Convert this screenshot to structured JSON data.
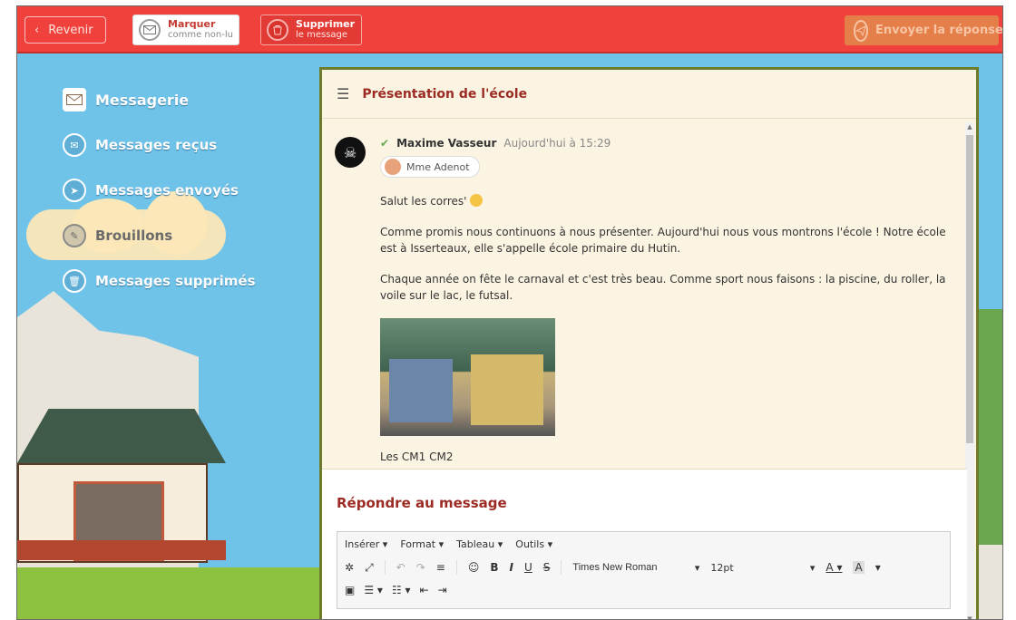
{
  "topbar": {
    "back_label": "Revenir",
    "mark_line1": "Marquer",
    "mark_line2": "comme non-lu",
    "delete_line1": "Supprimer",
    "delete_line2": "le message",
    "send_label": "Envoyer la réponse"
  },
  "nav": {
    "title": "Messagerie",
    "items": [
      {
        "label": "Messages reçus",
        "icon": "envelope-icon"
      },
      {
        "label": "Messages envoyés",
        "icon": "paper-plane-icon"
      },
      {
        "label": "Brouillons",
        "icon": "draft-icon"
      },
      {
        "label": "Messages supprimés",
        "icon": "trash-icon"
      }
    ],
    "active_index": 2
  },
  "panel": {
    "title": "Présentation de l'école",
    "message": {
      "sender": "Maxime Vasseur",
      "time": "Aujourd'hui à 15:29",
      "recipient": "Mme Adenot",
      "greeting": "Salut les corres'",
      "paragraph1": "Comme promis nous continuons à nous présenter. Aujourd'hui nous vous montrons l'école ! Notre école est à Isserteaux, elle s'appelle école primaire du Hutin.",
      "paragraph2": "Chaque année on fête le carnaval et c'est très beau. Comme sport nous faisons : la piscine, du roller, la voile sur le lac, le futsal.",
      "signature": "Les CM1 CM2"
    },
    "reply": {
      "title": "Répondre au message",
      "menu": [
        "Insérer ▾",
        "Format ▾",
        "Tableau ▾",
        "Outils ▾"
      ],
      "font": "Times New Roman",
      "size": "12pt"
    }
  },
  "colors": {
    "topbar": "#f0413c",
    "accent": "#9c2b24",
    "send": "#e57f4a",
    "panel_border": "#6e7b2a"
  }
}
